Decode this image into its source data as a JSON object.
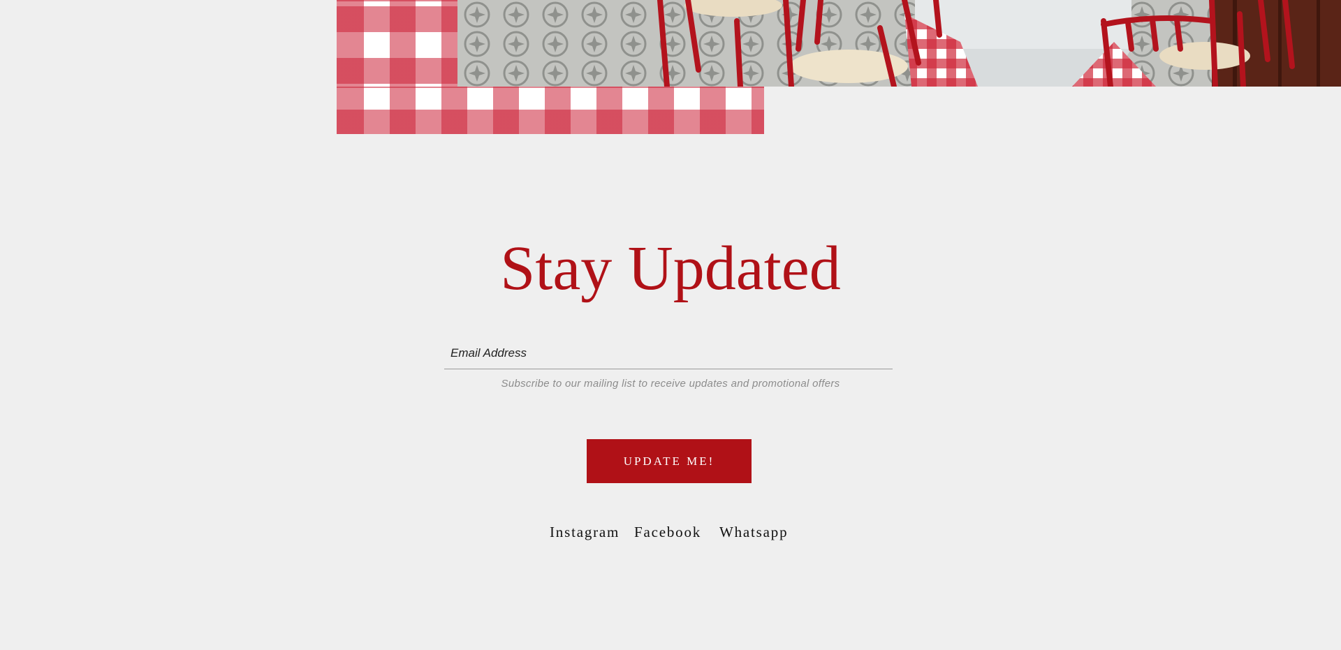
{
  "subscribe": {
    "title": "Stay Updated",
    "email_placeholder": "Email Address",
    "helper_text": "Subscribe to our mailing list to receive updates and promotional offers",
    "button_label": "UPDATE ME!"
  },
  "social_links": [
    "Instagram",
    "Facebook",
    "Whatsapp"
  ],
  "colors": {
    "accent": "#b01117",
    "background": "#efefef",
    "gingham_red": "#cc2238"
  }
}
